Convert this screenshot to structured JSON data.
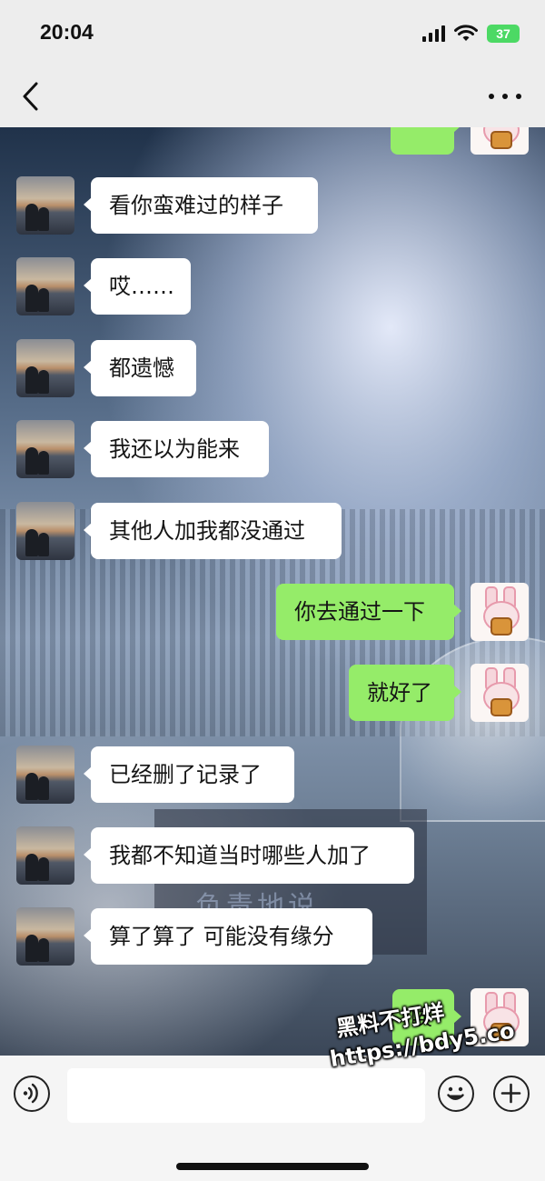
{
  "status_bar": {
    "time": "20:04",
    "battery": "37"
  },
  "watermark": {
    "line1": "黑料不打烊",
    "line2": "https://bdy5.co"
  },
  "stage_screen_text": "负责地说",
  "messages": [
    {
      "side": "right",
      "type": "emoji",
      "text": ""
    },
    {
      "side": "left",
      "text": "看你蛮难过的样子"
    },
    {
      "side": "left",
      "text": "哎……"
    },
    {
      "side": "left",
      "text": "都遗憾"
    },
    {
      "side": "left",
      "text": "我还以为能来"
    },
    {
      "side": "left",
      "text": "其他人加我都没通过"
    },
    {
      "side": "right",
      "text": "你去通过一下"
    },
    {
      "side": "right",
      "text": "就好了"
    },
    {
      "side": "left",
      "text": "已经删了记录了"
    },
    {
      "side": "left",
      "text": "我都不知道当时哪些人加了"
    },
    {
      "side": "left",
      "text": "算了算了 可能没有缘分"
    },
    {
      "side": "right",
      "text": "唉"
    }
  ],
  "input": {
    "placeholder": ""
  },
  "icons": {
    "back": "chevron-left-icon",
    "more": "more-dots-icon",
    "voice": "voice-icon",
    "emoji": "emoji-icon",
    "plus": "plus-icon"
  },
  "colors": {
    "bubble_self": "#95ec69",
    "bubble_other": "#ffffff",
    "bar_bg": "#ededed"
  }
}
